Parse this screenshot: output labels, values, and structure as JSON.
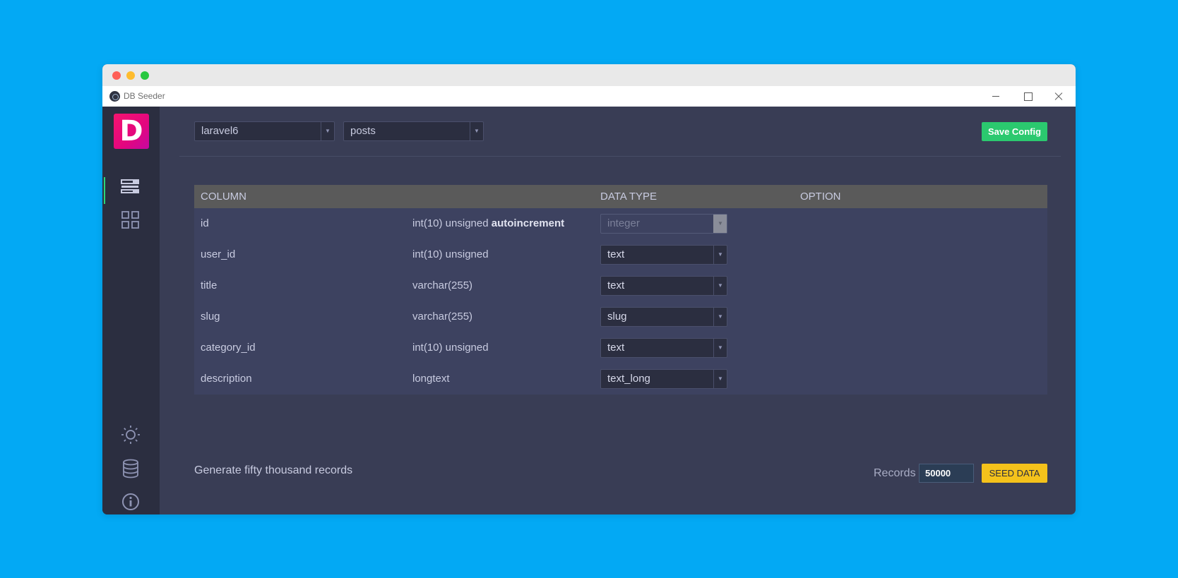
{
  "window": {
    "title": "DB Seeder"
  },
  "sidebar": {
    "logo_letter": "D",
    "items": [
      {
        "icon": "list-icon",
        "active": true
      },
      {
        "icon": "grid-icon",
        "active": false
      },
      {
        "icon": "sun-icon",
        "active": false
      },
      {
        "icon": "database-icon",
        "active": false
      },
      {
        "icon": "info-icon",
        "active": false
      }
    ]
  },
  "toolbar": {
    "database_select": "laravel6",
    "table_select": "posts",
    "save_label": "Save Config"
  },
  "table": {
    "headers": {
      "column": "COLUMN",
      "data_type": "DATA TYPE",
      "option": "OPTION"
    },
    "rows": [
      {
        "name": "id",
        "type": "int(10) unsigned ",
        "type_extra": "autoincrement",
        "data_type": "integer",
        "disabled": true
      },
      {
        "name": "user_id",
        "type": "int(10) unsigned",
        "type_extra": "",
        "data_type": "text",
        "disabled": false
      },
      {
        "name": "title",
        "type": "varchar(255)",
        "type_extra": "",
        "data_type": "text",
        "disabled": false
      },
      {
        "name": "slug",
        "type": "varchar(255)",
        "type_extra": "",
        "data_type": "slug",
        "disabled": false
      },
      {
        "name": "category_id",
        "type": "int(10) unsigned",
        "type_extra": "",
        "data_type": "text",
        "disabled": false
      },
      {
        "name": "description",
        "type": "longtext",
        "type_extra": "",
        "data_type": "text_long",
        "disabled": false
      }
    ]
  },
  "footer": {
    "summary": "Generate fifty thousand records",
    "records_label": "Records",
    "records_value": "50000",
    "seed_label": "SEED DATA"
  },
  "colors": {
    "background": "#03a9f4",
    "content": "#393d55",
    "sidebar": "#2b2e40",
    "accent_green": "#2bc96f",
    "accent_yellow": "#f4c21b",
    "logo_pink": "#f5146f"
  }
}
